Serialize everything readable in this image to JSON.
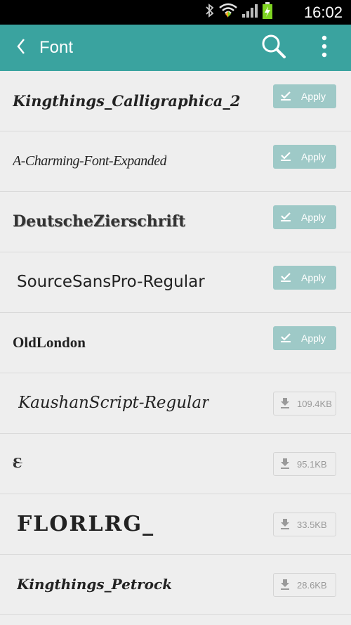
{
  "status_bar": {
    "time": "16:02",
    "icons": [
      "bluetooth-icon",
      "wifi-icon",
      "signal-icon",
      "battery-icon"
    ]
  },
  "app_bar": {
    "title": "Font",
    "back_icon": "chevron-left-icon",
    "search_icon": "search-icon",
    "more_icon": "more-vertical-icon",
    "color": "#3aa39f"
  },
  "fonts": [
    {
      "name": "Kingthings_Calligraphica_2",
      "action": "Apply"
    },
    {
      "name": "A-Charming-Font-Expanded",
      "action": "Apply"
    },
    {
      "name": "DeutscheZierschrift",
      "action": "Apply"
    },
    {
      "name": "SourceSansPro-Regular",
      "action": "Apply"
    },
    {
      "name": "OldLondon",
      "action": "Apply"
    },
    {
      "name": "KaushanScript-Regular",
      "size": "109.4KB"
    },
    {
      "name": "Ɛ",
      "size": "95.1KB"
    },
    {
      "name": "FLORLRG_",
      "size": "33.5KB"
    },
    {
      "name": "Kingthings_Petrock",
      "size": "28.6KB"
    }
  ],
  "colors": {
    "apply_button": "#9ec9c7",
    "background": "#eeeeee"
  }
}
